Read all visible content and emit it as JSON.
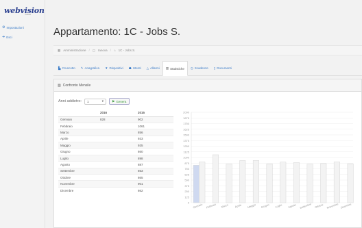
{
  "app": {
    "logo_text": "webvision",
    "logo_sub": "©2016",
    "nav": [
      {
        "label": "Impostazioni",
        "icon": "gear-icon"
      },
      {
        "label": "Esci",
        "icon": "logout-icon"
      }
    ]
  },
  "page": {
    "title": "Appartamento: 1C - Jobs S."
  },
  "breadcrumb": [
    {
      "label": "Amministrazione",
      "icon": "building-icon"
    },
    {
      "label": "Ianova",
      "icon": "doc-icon"
    },
    {
      "label": "1C - Jobs S.",
      "icon": "home-icon"
    }
  ],
  "tabs": [
    {
      "label": "Cruscotto",
      "icon": "dashboard-icon",
      "active": false
    },
    {
      "label": "Anagrafica",
      "icon": "edit-icon",
      "active": false
    },
    {
      "label": "Dispositivi",
      "icon": "filter-icon",
      "active": false
    },
    {
      "label": "Utenti",
      "icon": "users-icon",
      "active": false
    },
    {
      "label": "Allarmi",
      "icon": "bell-icon",
      "active": false
    },
    {
      "label": "Statistiche",
      "icon": "chart-icon",
      "active": true
    },
    {
      "label": "Scadenze",
      "icon": "clock-icon",
      "active": false
    },
    {
      "label": "Documenti",
      "icon": "file-icon",
      "active": false
    }
  ],
  "panel": {
    "title": "Confronto Mensile",
    "controls": {
      "label": "Anni addietro:",
      "select_value": "1",
      "button": "Genera"
    },
    "table": {
      "headers": [
        "",
        "2016",
        "2015"
      ],
      "rows": [
        [
          "Gennaio",
          "828",
          "902"
        ],
        [
          "Febbraio",
          "",
          "1061"
        ],
        [
          "Marzo",
          "",
          "856"
        ],
        [
          "Aprile",
          "",
          "933"
        ],
        [
          "Maggio",
          "",
          "935"
        ],
        [
          "Giugno",
          "",
          "860"
        ],
        [
          "Luglio",
          "",
          "898"
        ],
        [
          "Agosto",
          "",
          "887"
        ],
        [
          "Settembre",
          "",
          "853"
        ],
        [
          "Ottobre",
          "",
          "865"
        ],
        [
          "Novembre",
          "",
          "901"
        ],
        [
          "Dicembre",
          "",
          "862"
        ]
      ]
    }
  },
  "chart_data": {
    "type": "bar",
    "categories": [
      "Gennaio",
      "Febbraio",
      "Marzo",
      "Aprile",
      "Maggio",
      "Giugno",
      "Luglio",
      "Agosto",
      "Settembre",
      "Ottobre",
      "Novembre",
      "Dicembre"
    ],
    "series": [
      {
        "name": "2016",
        "values": [
          828,
          null,
          null,
          null,
          null,
          null,
          null,
          null,
          null,
          null,
          null,
          null
        ],
        "color": "#cfd9f0"
      },
      {
        "name": "2015",
        "values": [
          902,
          1061,
          856,
          933,
          935,
          860,
          898,
          887,
          853,
          865,
          901,
          862
        ],
        "color": "#f3f3f3"
      }
    ],
    "yticks": [
      "2000",
      "1875",
      "1750",
      "1625",
      "1500",
      "1375",
      "1250",
      "1125",
      "1000",
      "875",
      "750",
      "625",
      "500",
      "375",
      "250",
      "125",
      "0"
    ],
    "ylim": [
      0,
      2000
    ],
    "grid": true,
    "xlabel": "",
    "ylabel": ""
  }
}
